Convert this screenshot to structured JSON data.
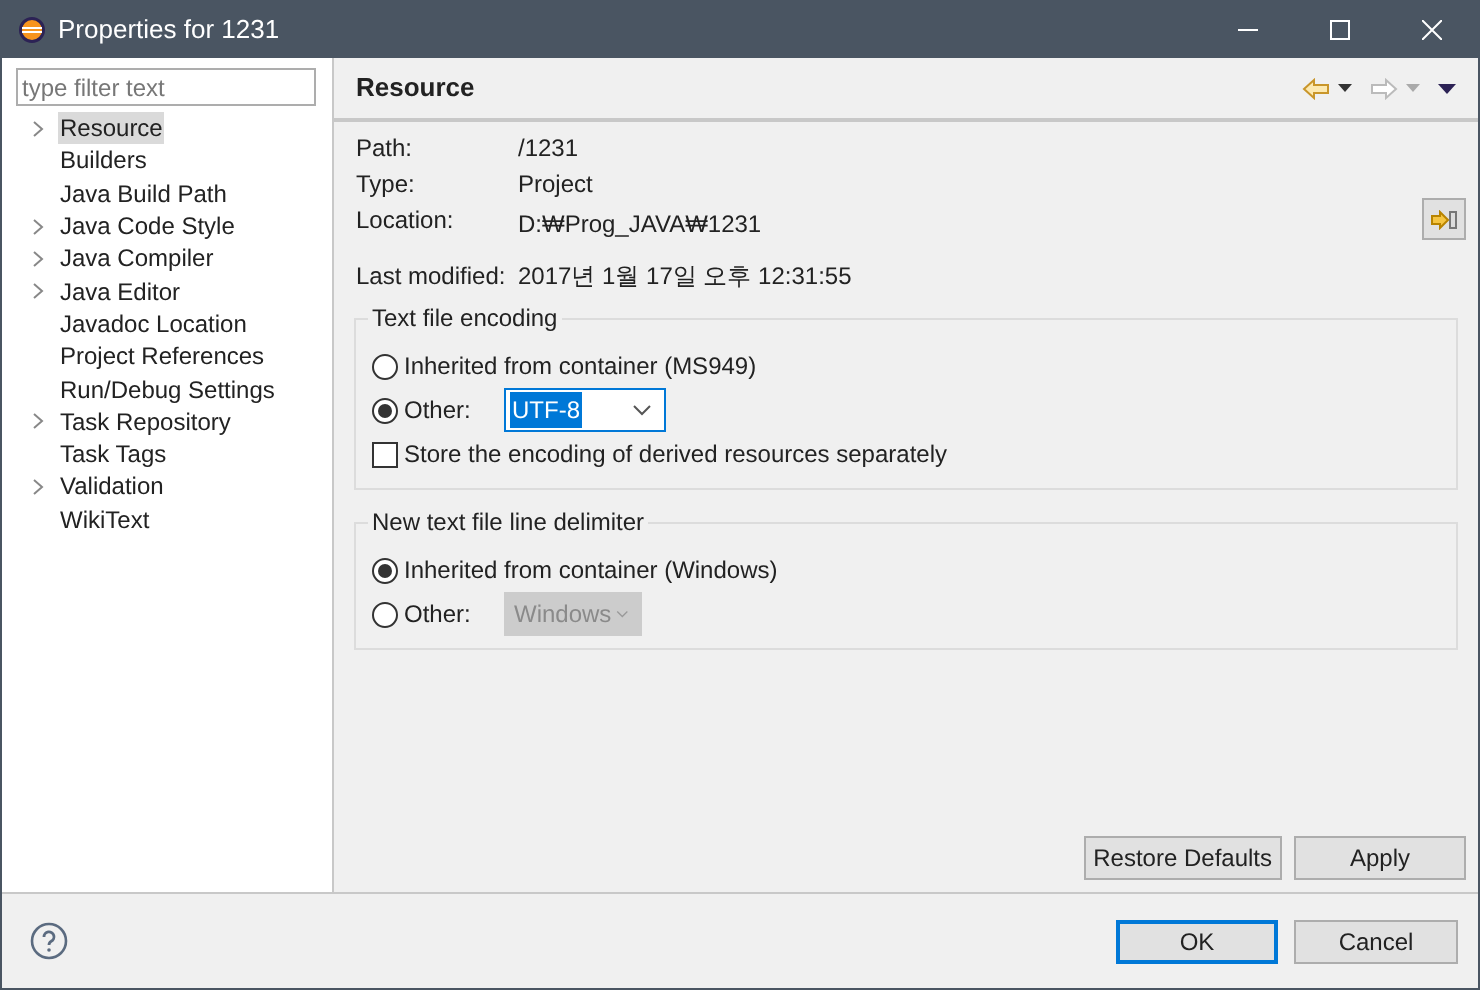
{
  "window": {
    "title": "Properties for 1231"
  },
  "filter": {
    "placeholder": "type filter text"
  },
  "tree": [
    {
      "label": "Resource",
      "expandable": true,
      "selected": true
    },
    {
      "label": "Builders",
      "expandable": false,
      "selected": false
    },
    {
      "label": "Java Build Path",
      "expandable": false,
      "selected": false
    },
    {
      "label": "Java Code Style",
      "expandable": true,
      "selected": false
    },
    {
      "label": "Java Compiler",
      "expandable": true,
      "selected": false
    },
    {
      "label": "Java Editor",
      "expandable": true,
      "selected": false
    },
    {
      "label": "Javadoc Location",
      "expandable": false,
      "selected": false
    },
    {
      "label": "Project References",
      "expandable": false,
      "selected": false
    },
    {
      "label": "Run/Debug Settings",
      "expandable": false,
      "selected": false
    },
    {
      "label": "Task Repository",
      "expandable": true,
      "selected": false
    },
    {
      "label": "Task Tags",
      "expandable": false,
      "selected": false
    },
    {
      "label": "Validation",
      "expandable": true,
      "selected": false
    },
    {
      "label": "WikiText",
      "expandable": false,
      "selected": false
    }
  ],
  "page": {
    "title": "Resource",
    "properties": [
      {
        "label": "Path:",
        "value": "/1231",
        "action": false
      },
      {
        "label": "Type:",
        "value": "Project",
        "action": false
      },
      {
        "label": "Location:",
        "value": "D:₩Prog_JAVA₩1231",
        "action": true
      },
      {
        "label": "Last modified:",
        "value": "2017년 1월 17일 오후 12:31:55",
        "action": false
      }
    ],
    "encoding": {
      "title": "Text file encoding",
      "inherited": {
        "label": "Inherited from container (MS949)",
        "selected": false
      },
      "other": {
        "label": "Other:",
        "selected": true,
        "value": "UTF-8",
        "disabled": false
      },
      "store_separately": {
        "label": "Store the encoding of derived resources separately",
        "checked": false
      }
    },
    "delimiter": {
      "title": "New text file line delimiter",
      "inherited": {
        "label": "Inherited from container (Windows)",
        "selected": true
      },
      "other": {
        "label": "Other:",
        "selected": false,
        "value": "Windows",
        "disabled": true
      }
    },
    "buttons": {
      "restore_defaults": "Restore Defaults",
      "apply": "Apply"
    }
  },
  "footer": {
    "ok": "OK",
    "cancel": "Cancel"
  }
}
